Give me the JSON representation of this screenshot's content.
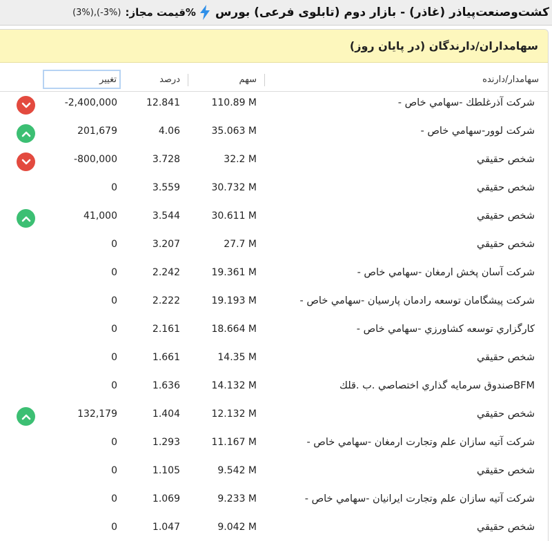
{
  "header": {
    "title": "کشت‌وصنعت‌پیاذر (غاذر) - بازار دوم (تابلوی فرعی) بورس",
    "price_limit_label": "%قیمت مجاز:",
    "price_limit_value": "(3%),(-3%)"
  },
  "panel": {
    "title": "سهامداران/دارندگان (در پایان روز)"
  },
  "columns": {
    "holder": "سهامدار/دارنده",
    "share": "سهم",
    "percent": "درصد",
    "change": "تغییر"
  },
  "colors": {
    "up": "#3cbf73",
    "down": "#e34a3f",
    "accent_yellow": "#fdf7bd",
    "bolt": "#2f8fe8"
  },
  "rows": [
    {
      "holder": "شركت آذرغلطك -سهامي خاص -",
      "share": "110.89 M",
      "percent": "12.841",
      "change": "-2,400,000",
      "trend": "down"
    },
    {
      "holder": "شركت لوور-سهامي خاص -",
      "share": "35.063 M",
      "percent": "4.06",
      "change": "201,679",
      "trend": "up"
    },
    {
      "holder": "شخص حقيقي",
      "share": "32.2 M",
      "percent": "3.728",
      "change": "-800,000",
      "trend": "down"
    },
    {
      "holder": "شخص حقيقي",
      "share": "30.732 M",
      "percent": "3.559",
      "change": "0",
      "trend": ""
    },
    {
      "holder": "شخص حقيقي",
      "share": "30.611 M",
      "percent": "3.544",
      "change": "41,000",
      "trend": "up"
    },
    {
      "holder": "شخص حقيقي",
      "share": "27.7 M",
      "percent": "3.207",
      "change": "0",
      "trend": ""
    },
    {
      "holder": "شركت آسان پخش ارمغان -سهامي خاص -",
      "share": "19.361 M",
      "percent": "2.242",
      "change": "0",
      "trend": ""
    },
    {
      "holder": "شركت پيشگامان توسعه رادمان پارسيان -سهامي خاص -",
      "share": "19.193 M",
      "percent": "2.222",
      "change": "0",
      "trend": ""
    },
    {
      "holder": "كارگزاري توسعه كشاورزي -سهامي خاص -",
      "share": "18.664 M",
      "percent": "2.161",
      "change": "0",
      "trend": ""
    },
    {
      "holder": "شخص حقيقي",
      "share": "14.35 M",
      "percent": "1.661",
      "change": "0",
      "trend": ""
    },
    {
      "holder": "BFMصندوق سرمايه گذاري اختصاصي .ب .قلك",
      "share": "14.132 M",
      "percent": "1.636",
      "change": "0",
      "trend": ""
    },
    {
      "holder": "شخص حقيقي",
      "share": "12.132 M",
      "percent": "1.404",
      "change": "132,179",
      "trend": "up"
    },
    {
      "holder": "شركت آتيه سازان علم وتجارت ارمغان -سهامي خاص -",
      "share": "11.167 M",
      "percent": "1.293",
      "change": "0",
      "trend": ""
    },
    {
      "holder": "شخص حقيقي",
      "share": "9.542 M",
      "percent": "1.105",
      "change": "0",
      "trend": ""
    },
    {
      "holder": "شركت آتيه سازان علم وتجارت ايرانيان -سهامي خاص -",
      "share": "9.233 M",
      "percent": "1.069",
      "change": "0",
      "trend": ""
    },
    {
      "holder": "شخص حقيقي",
      "share": "9.042 M",
      "percent": "1.047",
      "change": "0",
      "trend": ""
    }
  ]
}
